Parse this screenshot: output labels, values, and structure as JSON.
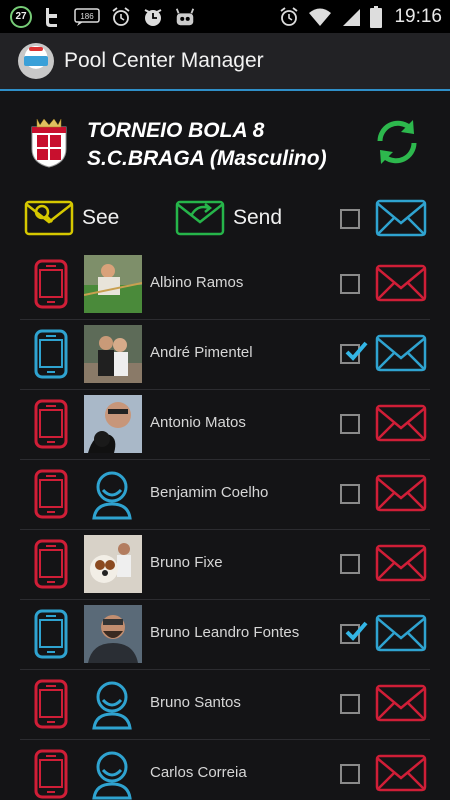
{
  "status_bar": {
    "notification_badge": "27",
    "sms_count": "186",
    "time": "19:16",
    "icons": [
      "notification-badge-icon",
      "twitter-icon",
      "sms-icon",
      "alarm-icon",
      "clock-icon",
      "robot-icon",
      "alarm-icon",
      "wifi-icon",
      "signal-icon",
      "battery-icon"
    ]
  },
  "app_bar": {
    "title": "Pool Center Manager",
    "logo_icon": "pool-ball-logo-icon",
    "accent_color": "#2f8fc8"
  },
  "tournament": {
    "title_line1": "TORNEIO BOLA 8",
    "title_line2": "S.C.BRAGA (Masculino)",
    "crest_icon": "club-crest-icon",
    "refresh_icon": "refresh-icon"
  },
  "actions": {
    "see_label": "See",
    "send_label": "Send",
    "select_all_checked": false,
    "see_color": "#d6c800",
    "send_color": "#26b54a",
    "mail_color": "#2fa3d0"
  },
  "colors": {
    "inactive": "#d01e37",
    "active": "#2fa3d0"
  },
  "contacts": [
    {
      "name": "Albino Ramos",
      "has_photo": true,
      "active": false,
      "checked": false
    },
    {
      "name": "André Pimentel",
      "has_photo": true,
      "active": true,
      "checked": true
    },
    {
      "name": "Antonio Matos",
      "has_photo": true,
      "active": false,
      "checked": false
    },
    {
      "name": "Benjamim Coelho",
      "has_photo": false,
      "active": false,
      "checked": false
    },
    {
      "name": "Bruno Fixe",
      "has_photo": true,
      "active": false,
      "checked": false
    },
    {
      "name": "Bruno Leandro Fontes",
      "has_photo": true,
      "active": true,
      "checked": true
    },
    {
      "name": "Bruno Santos",
      "has_photo": false,
      "active": false,
      "checked": false
    },
    {
      "name": "Carlos Correia",
      "has_photo": false,
      "active": false,
      "checked": false
    }
  ]
}
